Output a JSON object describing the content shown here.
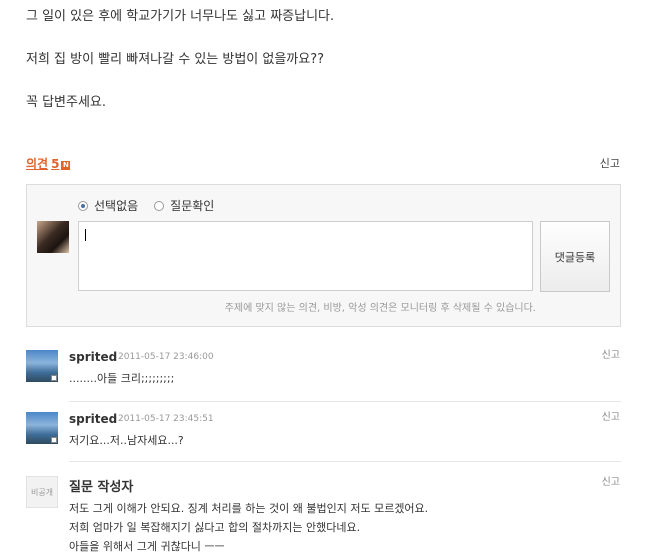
{
  "question": {
    "paragraphs": [
      "그 일이 있은 후에 학교가기가 너무나도 싫고 짜증납니다.",
      "저희 집 방이 빨리 빠져나갈 수 있는 방법이 없을까요??",
      "꼭 답변주세요."
    ]
  },
  "comments_header": {
    "label": "의견",
    "count": "5",
    "new_badge": "N",
    "report": "신고"
  },
  "write_form": {
    "radio_options": [
      "선택없음",
      "질문확인"
    ],
    "selected": "선택없음",
    "input_value": "",
    "submit_label": "댓글등록",
    "notice": "주제에 맞지 않는 의견, 비방, 악성 의견은 모니터링 후 삭제될 수 있습니다."
  },
  "comments": [
    {
      "author": "sprited",
      "date": "2011-05-17 23:46:00",
      "text": "........아들 크리;;;;;;;;;",
      "report": "신고"
    },
    {
      "author": "sprited",
      "date": "2011-05-17 23:45:51",
      "text": "저기요...저..남자세요...?",
      "report": "신고"
    },
    {
      "author": "질문 작성자",
      "avatar_text": "비공개",
      "report": "신고",
      "lines": [
        "저도 그게 이해가 안되요. 징계 처리를 하는 것이 왜 불법인지 저도 모르겠어요.",
        "저희 엄마가 일 복잡해지기 싫다고 합의 절차까지는 안했다네요.",
        "아들을 위해서 그게 귀찮다니 ㅡㅡ"
      ]
    }
  ],
  "colors": {
    "accent": "#e0632a",
    "border": "#dcdcdc",
    "muted": "#999999"
  },
  "icons": {
    "new_badge": "new-badge-icon",
    "radio": "radio-icon"
  }
}
